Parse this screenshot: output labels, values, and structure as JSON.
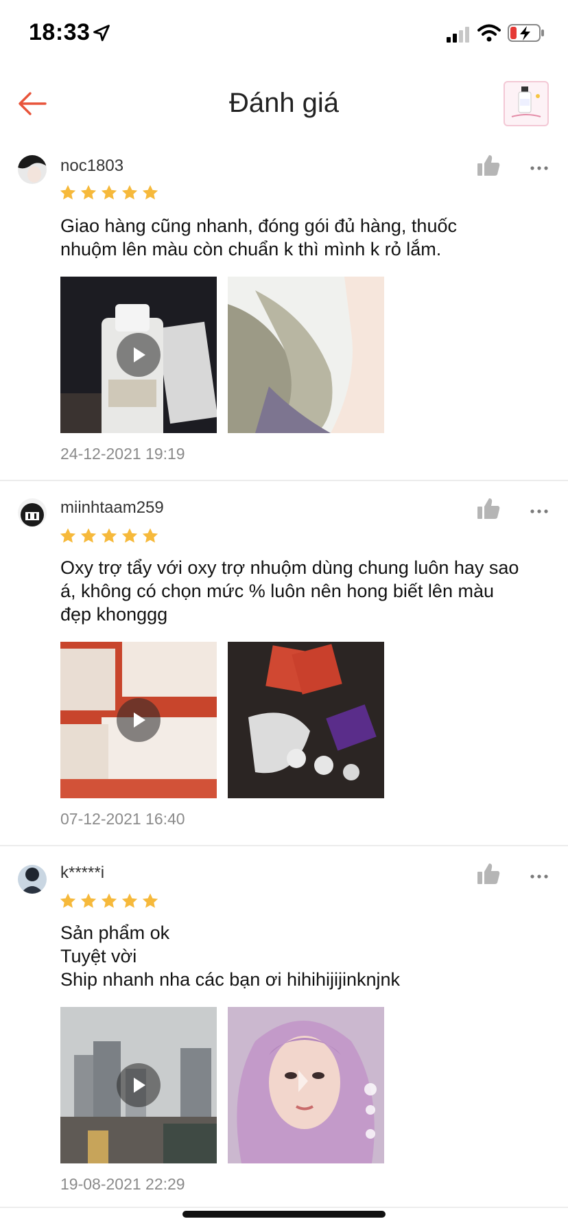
{
  "status_bar": {
    "time": "18:33"
  },
  "header": {
    "title": "Đánh giá",
    "back_icon": "arrow-left-icon",
    "accent": "#ee4d2d"
  },
  "colors": {
    "star": "#f6b93b",
    "divider": "#ececec",
    "meta_text": "#8a8a8a"
  },
  "reviews": [
    {
      "username": "noc1803",
      "rating": 5,
      "text": "Giao hàng cũng nhanh, đóng gói đủ hàng, thuốc\nnhuộm lên màu còn chuẩn k thì mình k rỏ lắm.",
      "media": [
        {
          "type": "video",
          "desc": "bottle"
        },
        {
          "type": "image",
          "desc": "hair"
        }
      ],
      "date": "24-12-2021 19:19"
    },
    {
      "username": "miinhtaam259",
      "rating": 5,
      "text": "Oxy trợ tẩy với oxy trợ nhuộm dùng chung luôn hay sao\ná, không có chọn mức % luôn nên hong biết lên màu\nđẹp khonggg",
      "media": [
        {
          "type": "video",
          "desc": "hair dye boxes"
        },
        {
          "type": "image",
          "desc": "dye products"
        }
      ],
      "date": "07-12-2021 16:40"
    },
    {
      "username": "k*****i",
      "rating": 5,
      "text": "Sản phẩm ok\nTuyệt vời\nShip nhanh nha  các bạn ơi hihihijijinknjnk",
      "media": [
        {
          "type": "video",
          "desc": "city view"
        },
        {
          "type": "image",
          "desc": "purple hair"
        }
      ],
      "date": "19-08-2021 22:29"
    }
  ]
}
